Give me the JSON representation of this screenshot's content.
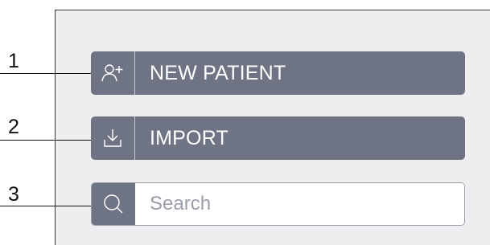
{
  "callouts": [
    "1",
    "2",
    "3"
  ],
  "buttons": {
    "new_patient": {
      "label": "NEW PATIENT",
      "icon": "add-user-icon"
    },
    "import": {
      "label": "IMPORT",
      "icon": "download-icon"
    }
  },
  "search": {
    "placeholder": "Search",
    "value": "",
    "icon": "search-icon"
  },
  "colors": {
    "button_bg": "#6e7484",
    "panel_bg": "#eeeef0",
    "button_text": "#ffffff",
    "placeholder_text": "#9a9ea8"
  }
}
